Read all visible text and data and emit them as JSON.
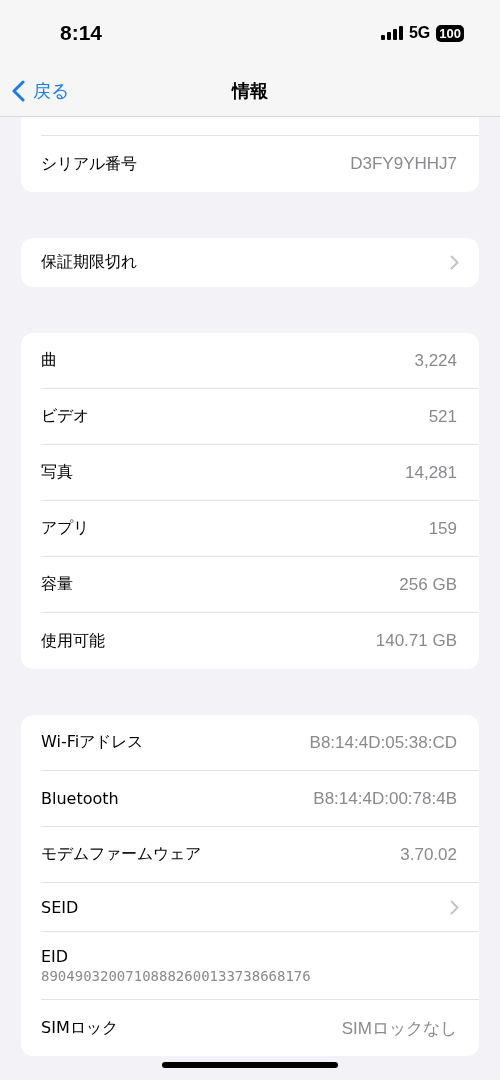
{
  "status_bar": {
    "time": "8:14",
    "network": "5G",
    "battery": "100"
  },
  "nav": {
    "back": "戻る",
    "title": "情報"
  },
  "sections": [
    {
      "cut_top": true,
      "rows": [
        {
          "kind": "value",
          "label": "シリアル番号",
          "value": "D3FY9YHHJ7"
        }
      ]
    },
    {
      "rows": [
        {
          "kind": "link",
          "label": "保証期限切れ"
        }
      ]
    },
    {
      "rows": [
        {
          "kind": "value",
          "label": "曲",
          "value": "3,224"
        },
        {
          "kind": "value",
          "label": "ビデオ",
          "value": "521"
        },
        {
          "kind": "value",
          "label": "写真",
          "value": "14,281"
        },
        {
          "kind": "value",
          "label": "アプリ",
          "value": "159"
        },
        {
          "kind": "value",
          "label": "容量",
          "value": "256 GB"
        },
        {
          "kind": "value",
          "label": "使用可能",
          "value": "140.71 GB"
        }
      ]
    },
    {
      "rows": [
        {
          "kind": "value",
          "label": "Wi-Fiアドレス",
          "value": "B8:14:4D:05:38:CD"
        },
        {
          "kind": "value",
          "label": "Bluetooth",
          "value": "B8:14:4D:00:78:4B"
        },
        {
          "kind": "value",
          "label": "モデムファームウェア",
          "value": "3.70.02"
        },
        {
          "kind": "link",
          "label": "SEID"
        },
        {
          "kind": "stacked",
          "label": "EID",
          "value": "89049032007108882600133738668176"
        },
        {
          "kind": "value",
          "label": "SIMロック",
          "value": "SIMロックなし"
        }
      ]
    }
  ]
}
